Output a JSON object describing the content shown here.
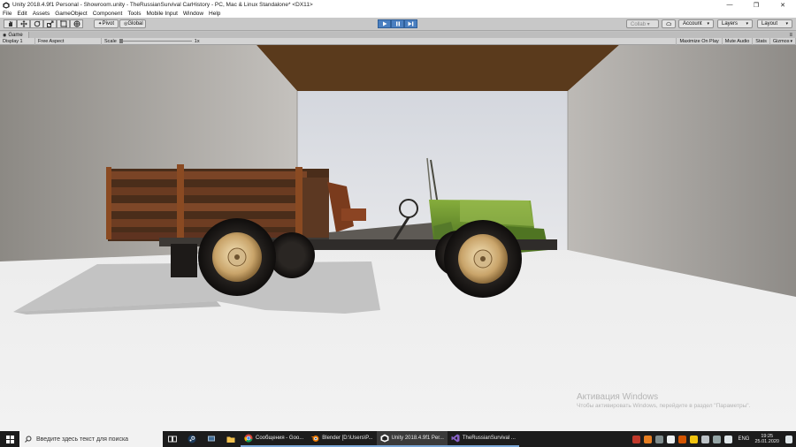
{
  "window": {
    "title": "Unity 2018.4.9f1 Personal - Showroom.unity - TheRussianSurvival CarHistory - PC, Mac & Linux Standalone* <DX11>",
    "minimize": "—",
    "maximize": "❐",
    "close": "✕"
  },
  "menu": [
    "File",
    "Edit",
    "Assets",
    "GameObject",
    "Component",
    "Tools",
    "Mobile Input",
    "Window",
    "Help"
  ],
  "toolbar": {
    "pivot_label": "Pivot",
    "global_label": "Global",
    "collab_label": "Collab ▾",
    "account_label": "Account",
    "layers_label": "Layers",
    "layout_label": "Layout"
  },
  "game_tab": {
    "label": "Game"
  },
  "game_bar": {
    "display_label": "Display 1",
    "aspect_label": "Free Aspect",
    "scale_label": "Scale",
    "scale_value": "1x",
    "maximize_label": "Maximize On Play",
    "mute_label": "Mute Audio",
    "stats_label": "Stats",
    "gizmos_label": "Gizmos"
  },
  "watermark": {
    "title": "Активация Windows",
    "subtitle": "Чтобы активировать Windows, перейдите в раздел \"Параметры\"."
  },
  "taskbar": {
    "search_placeholder": "Введите здесь текст для поиска",
    "apps": [
      {
        "label": "Сообщения - Goo...",
        "icon": "chrome-icon"
      },
      {
        "label": "Blender [D:\\Users\\P...",
        "icon": "blender-icon"
      },
      {
        "label": "Unity 2018.4.9f1 Per...",
        "icon": "unity-icon"
      },
      {
        "label": "TheRussianSurvival ...",
        "icon": "visual-studio-icon"
      }
    ],
    "language": "ENG",
    "time": "19:25",
    "date": "25.01.2020"
  },
  "colors": {
    "play_active": "#4a7fc0",
    "truck_green": "#6f9a2e",
    "rust": "#8a4a22",
    "ceiling": "#5a3a1c"
  }
}
